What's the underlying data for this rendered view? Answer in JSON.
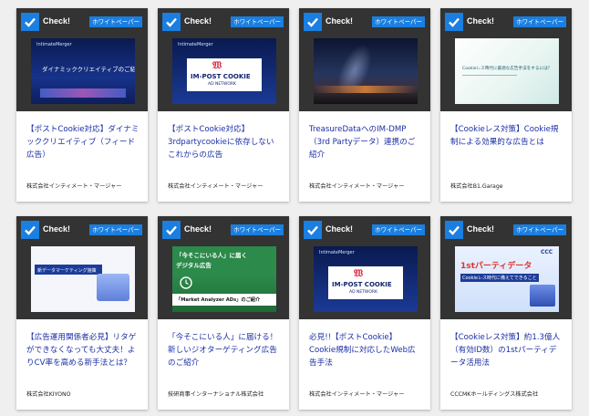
{
  "theme": {
    "accent": "#1a7fe0",
    "title_color": "#1b2fa6",
    "card_header": "#333333"
  },
  "cards": [
    {
      "check": "Check!",
      "badge": "ホワイトペーパー",
      "title": "【ポストCookie対応】ダイナミッククリエイティブ（フィード広告）",
      "company": "株式会社インティメート・マージャー",
      "thumb_text": "ダイナミッククリエイティブのご紹介",
      "thumb_logo": "IntimateMerger"
    },
    {
      "check": "Check!",
      "badge": "ホワイトペーパー",
      "title": "【ポストCookie対応】3rdpartycookieに依存しないこれからの広告",
      "company": "株式会社インティメート・マージャー",
      "thumb_text": "IM-POST COOKIE",
      "thumb_sub": "AD NETWORK",
      "thumb_logo": "IntimateMerger"
    },
    {
      "check": "Check!",
      "badge": "ホワイトペーパー",
      "title": "TreasureDataへのIM-DMP（3rd Partyデータ）連携のご紹介",
      "company": "株式会社インティメート・マージャー"
    },
    {
      "check": "Check!",
      "badge": "ホワイトペーパー",
      "title": "【Cookieレス対策】Cookie規制による効果的な広告とは",
      "company": "株式会社B1.Garage",
      "thumb_text": "Cookieレス時代に最適な広告手法をするには？"
    },
    {
      "check": "Check!",
      "badge": "ホワイトペーパー",
      "title": "【広告運用関係者必見】リタゲができなくなっても大丈夫！よりCV率を高める新手法とは？",
      "company": "株式会社KIYONO",
      "thumb_text": "新データマーケティング施策"
    },
    {
      "check": "Check!",
      "badge": "ホワイトペーパー",
      "title": "「今そこにいる人」に届ける！新しいジオターゲティング広告のご紹介",
      "company": "技研商事インターナショナル株式会社",
      "thumb_text": "「今そこにいる人」に届く",
      "thumb_sub": "デジタル広告",
      "thumb_foot": "「Market Analyzer ADs」のご紹介"
    },
    {
      "check": "Check!",
      "badge": "ホワイトペーパー",
      "title": "必見!!【ポストCookie】Cookie規制に対応したWeb広告手法",
      "company": "株式会社インティメート・マージャー",
      "thumb_text": "IM-POST COOKIE",
      "thumb_sub": "AD NETWORK",
      "thumb_logo": "IntimateMerger"
    },
    {
      "check": "Check!",
      "badge": "ホワイトペーパー",
      "title": "【Cookieレス対策】約1.3億人（有効ID数）の1stパーティデータ活用法",
      "company": "CCCMKホールディングス株式会社",
      "thumb_text": "1stパーティデータ",
      "thumb_sub": "Cookieレス時代に備えてできること",
      "thumb_logo": "CCC"
    }
  ]
}
